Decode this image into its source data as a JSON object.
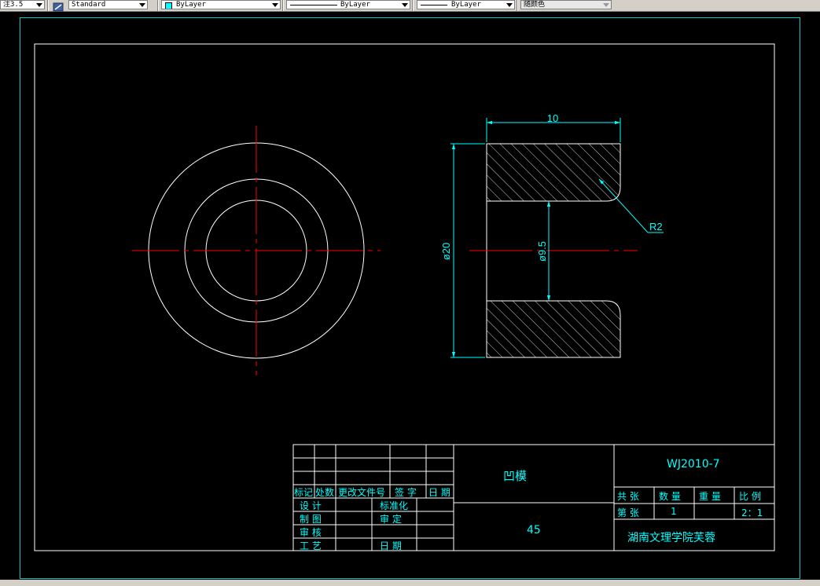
{
  "toolbar": {
    "textstyle_value": "注3.5",
    "dimstyle_value": "Standard",
    "layer_value": "ByLayer",
    "linetype_value": "ByLayer",
    "lineweight_value": "ByLayer",
    "color_value": "随颜色"
  },
  "dims": {
    "width": "10",
    "outer_dia": "ø20",
    "inner_dia": "ø9.5",
    "radius": "R2"
  },
  "title_block": {
    "rev_headers": [
      "标记",
      "处数",
      "更改文件号",
      "签 字",
      "日 期"
    ],
    "roles": [
      "设 计",
      "制 图",
      "审 核",
      "工 艺"
    ],
    "standardization": "标准化",
    "approve": "审 定",
    "date": "日 期",
    "part_name": "凹模",
    "material": "45",
    "drawing_number": "WJ2010-7",
    "total_sheets_label": "共 张",
    "quantity_label": "数 量",
    "weight_label": "重 量",
    "scale_label": "比 例",
    "sheet_label": "第 张",
    "quantity_value": "1",
    "scale_value": "2：1",
    "school": "湖南文理学院芙蓉"
  },
  "colors": {
    "outline": "#ffffff",
    "centerline": "#ff0000",
    "dimension": "#00ffff",
    "background": "#000000"
  }
}
